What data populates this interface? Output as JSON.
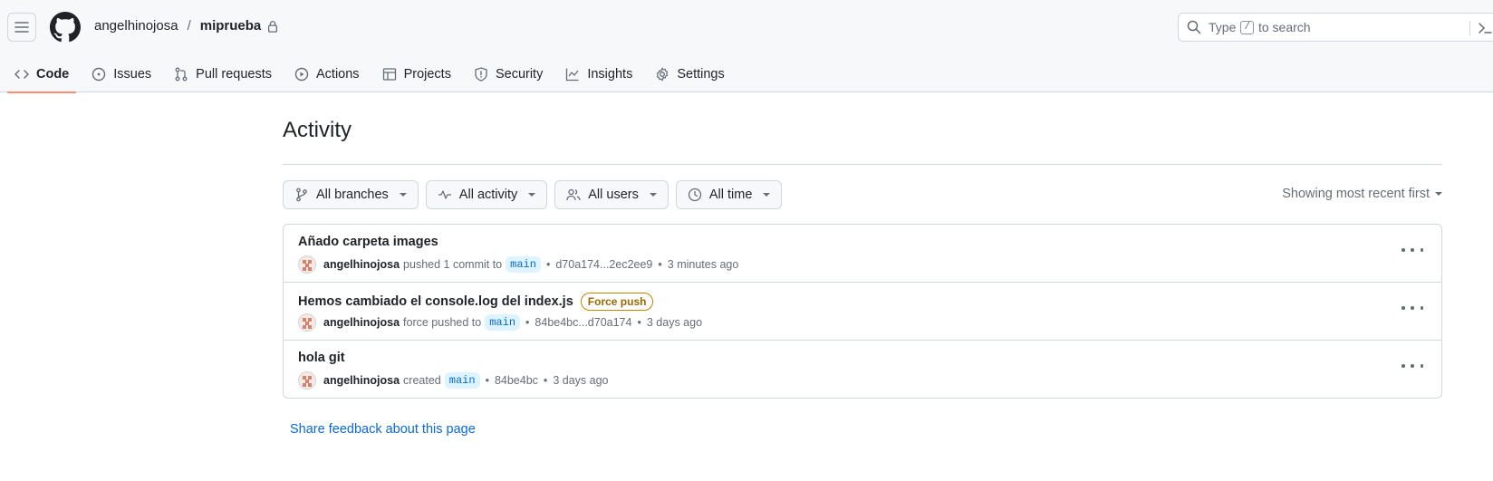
{
  "header": {
    "owner": "angelhinojosa",
    "separator": "/",
    "repo": "miprueba",
    "search_prefix": "Type",
    "search_key": "/",
    "search_suffix": "to search"
  },
  "tabs": [
    {
      "label": "Code",
      "icon": "code-icon",
      "selected": true
    },
    {
      "label": "Issues",
      "icon": "issue-icon",
      "selected": false
    },
    {
      "label": "Pull requests",
      "icon": "pull-request-icon",
      "selected": false
    },
    {
      "label": "Actions",
      "icon": "play-icon",
      "selected": false
    },
    {
      "label": "Projects",
      "icon": "table-icon",
      "selected": false
    },
    {
      "label": "Security",
      "icon": "shield-icon",
      "selected": false
    },
    {
      "label": "Insights",
      "icon": "graph-icon",
      "selected": false
    },
    {
      "label": "Settings",
      "icon": "gear-icon",
      "selected": false
    }
  ],
  "page": {
    "title": "Activity",
    "sort_label": "Showing most recent first",
    "feedback_link": "Share feedback about this page"
  },
  "filters": {
    "branches": "All branches",
    "activity": "All activity",
    "users": "All users",
    "time": "All time"
  },
  "activities": [
    {
      "title": "Añado carpeta images",
      "badge": "",
      "user": "angelhinojosa",
      "action": "pushed 1 commit to",
      "branch": "main",
      "ref": "d70a174...2ec2ee9",
      "time": "3 minutes ago"
    },
    {
      "title": "Hemos cambiado el console.log del index.js",
      "badge": "Force push",
      "user": "angelhinojosa",
      "action": "force pushed to",
      "branch": "main",
      "ref": "84be4bc...d70a174",
      "time": "3 days ago"
    },
    {
      "title": "hola git",
      "badge": "",
      "user": "angelhinojosa",
      "action": "created",
      "branch": "main",
      "ref": "84be4bc",
      "time": "3 days ago"
    }
  ],
  "colors": {
    "accent": "#0969da",
    "tab_underline": "#fd8c73",
    "badge": "#9a6700"
  }
}
